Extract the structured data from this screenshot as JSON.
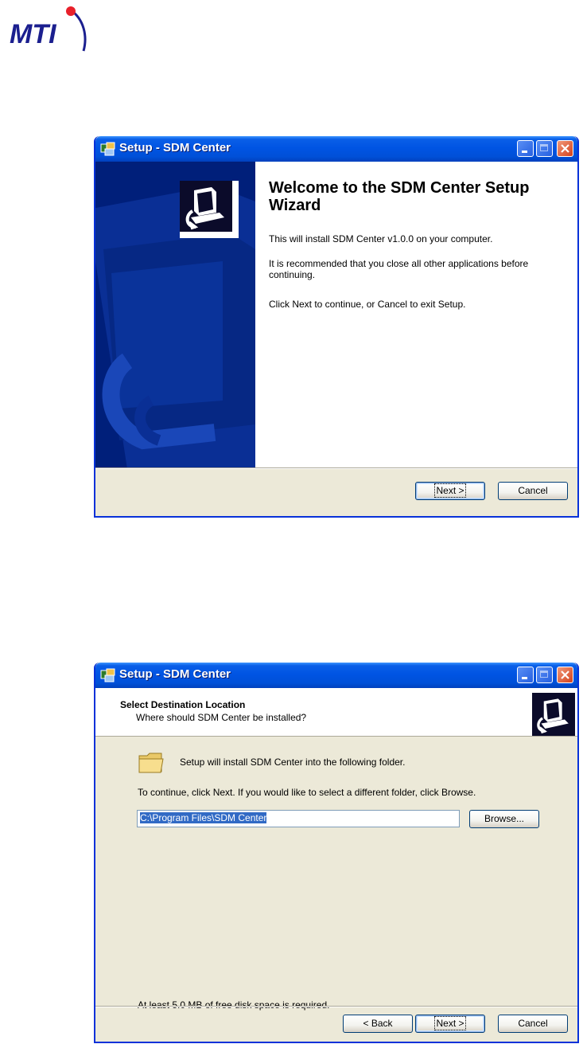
{
  "logo": {
    "text": "MTI",
    "color": "#1b1f8f",
    "dot_color": "#e8202a"
  },
  "window1": {
    "title": "Setup - SDM Center",
    "heading": "Welcome to the SDM Center Setup Wizard",
    "paragraphs": [
      "This will install SDM Center v1.0.0 on your computer.",
      "It is recommended that you close all other applications before continuing.",
      "Click Next to continue, or Cancel to exit Setup."
    ],
    "buttons": {
      "next": "Next >",
      "cancel": "Cancel"
    }
  },
  "window2": {
    "title": "Setup - SDM Center",
    "heading": "Select Destination Location",
    "subheading": "Where should SDM Center be installed?",
    "intro": "Setup will install SDM Center into the following folder.",
    "instruction": "To continue, click Next. If you would like to select a different folder, click Browse.",
    "path_value": "C:\\Program Files\\SDM Center",
    "browse": "Browse...",
    "disk_space": "At least 5.0 MB of free disk space is required.",
    "buttons": {
      "back": "< Back",
      "next": "Next >",
      "cancel": "Cancel"
    }
  },
  "colors": {
    "titlebar": "#0054e3",
    "sidebar": "#001f7a",
    "dialog_bg": "#ece9d8",
    "selection": "#316ac5"
  }
}
